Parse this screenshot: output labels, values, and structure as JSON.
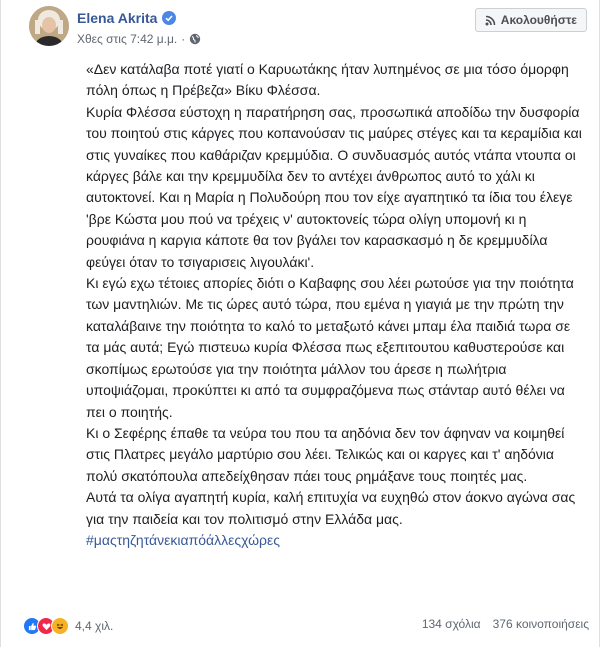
{
  "author": {
    "name": "Elena Akrita",
    "verified": true
  },
  "post_meta": {
    "time": "Χθες στις 7:42 μ.μ.",
    "separator": "·",
    "privacy_icon": "globe-icon"
  },
  "follow_button": {
    "label": "Ακολουθήστε",
    "icon": "rss-icon"
  },
  "content": {
    "paragraphs": [
      "«Δεν κατάλαβα ποτέ γιατί ο Καρυωτάκης ήταν λυπημένος σε μια τόσο όμορφη πόλη όπως η Πρέβεζα» Βίκυ Φλέσσα.",
      "Κυρία Φλέσσα εύστοχη η παρατήρηση σας, προσωπικά αποδίδω την δυσφορία του ποιητού στις κάργες που κοπανούσαν τις μαύρες στέγες και τα κεραμίδια και στις γυναίκες που καθάριζαν κρεμμύδια. Ο συνδυασμός αυτός ντάπα ντουπα οι κάργες βάλε και την κρεμμυδίλα δεν το αντέχει άνθρωπος αυτό το χάλι κι αυτοκτονεί. Και η Μαρία η Πολυδούρη που τον είχε αγαπητικό τα ίδια του έλεγε 'βρε Κώστα μου πού να τρέχεις ν' αυτοκτονείς τώρα ολίγη υπομονή κι η ρουφιάνα η καργια κάποτε θα τον βγάλει τον καρασκασμό η δε κρεμμυδίλα φεύγει όταν το τσιγαρισεις λιγουλάκι'.",
      "Κι εγώ εχω τέτοιες απορίες διότι ο Καβαφης σου λέει ρωτούσε για την ποιότητα των μαντηλιών. Με τις ώρες αυτό τώρα, που εμένα η γιαγιά με την πρώτη την καταλάβαινε την ποιότητα το καλό το μεταξωτό κάνει μπαμ έλα παιδιά τωρα σε τα μάς αυτά; Εγώ πιστευω κυρία Φλέσσα πως εξεπιτουτου καθυστερούσε και σκοπίμως ερωτούσε για την ποιότητα μάλλον του άρεσε η πωλήτρια υποψιάζομαι, προκύπτει κι από τα συμφραζόμενα πως στάνταρ αυτό θέλει να πει ο ποιητής.",
      "Κι ο Σεφέρης έπαθε τα νεύρα του που τα αηδόνια δεν τον άφηναν να κοιμηθεί στις Πλατρες μεγάλο μαρτύριο σου λέει. Τελικώς και οι καργες και τ' αηδόνια πολύ σκατόπουλα απεδείχθησαν πάει τους ρημάξανε τους ποιητές μας.",
      "Αυτά τα ολίγα αγαπητή κυρία, καλή επιτυχία να ευχηθώ στον άοκνο αγώνα σας για την παιδεία και τον πολιτισμό στην Ελλάδα μας."
    ],
    "hashtag": "#μαςτηζητάνεκιαπόάλλεςχώρες"
  },
  "footer": {
    "reactions": [
      "like-icon",
      "love-icon",
      "haha-icon"
    ],
    "reaction_count": "4,4 χιλ.",
    "comments": "134 σχόλια",
    "shares": "376 κοινοποιήσεις"
  },
  "colors": {
    "link": "#385898",
    "verified": "#4b88e6",
    "like": "#2078f4",
    "love": "#f0284a",
    "haha": "#f7b125"
  }
}
